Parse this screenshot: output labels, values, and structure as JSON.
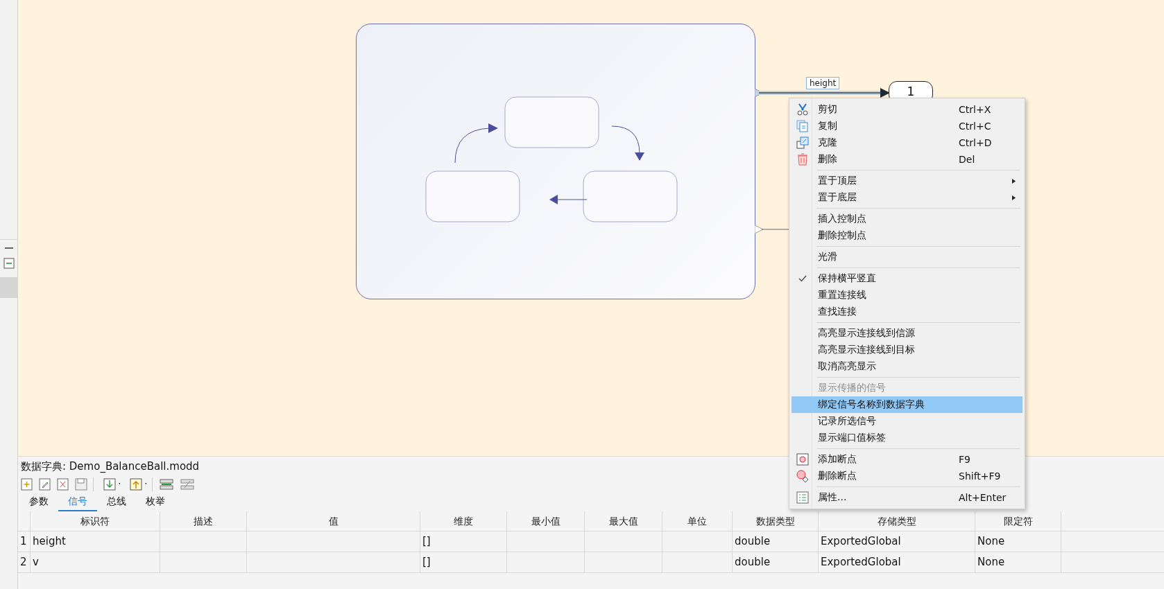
{
  "diagram": {
    "signal_label": "height",
    "outport_label": "1"
  },
  "context_menu": {
    "groups": [
      [
        {
          "label": "剪切",
          "shortcut": "Ctrl+X",
          "has_submenu": false,
          "checked": false,
          "disabled": false,
          "selected": false
        },
        {
          "label": "复制",
          "shortcut": "Ctrl+C",
          "has_submenu": false,
          "checked": false,
          "disabled": false,
          "selected": false
        },
        {
          "label": "克隆",
          "shortcut": "Ctrl+D",
          "has_submenu": false,
          "checked": false,
          "disabled": false,
          "selected": false
        },
        {
          "label": "删除",
          "shortcut": "Del",
          "has_submenu": false,
          "checked": false,
          "disabled": false,
          "selected": false
        }
      ],
      [
        {
          "label": "置于顶层",
          "has_submenu": true,
          "checked": false,
          "disabled": false,
          "selected": false
        },
        {
          "label": "置于底层",
          "has_submenu": true,
          "checked": false,
          "disabled": false,
          "selected": false
        }
      ],
      [
        {
          "label": "插入控制点",
          "has_submenu": false,
          "checked": false,
          "disabled": false,
          "selected": false
        },
        {
          "label": "删除控制点",
          "has_submenu": false,
          "checked": false,
          "disabled": false,
          "selected": false
        }
      ],
      [
        {
          "label": "光滑",
          "has_submenu": false,
          "checked": false,
          "disabled": false,
          "selected": false
        }
      ],
      [
        {
          "label": "保持横平竖直",
          "has_submenu": false,
          "checked": true,
          "disabled": false,
          "selected": false
        },
        {
          "label": "重置连接线",
          "has_submenu": false,
          "checked": false,
          "disabled": false,
          "selected": false
        },
        {
          "label": "查找连接",
          "has_submenu": false,
          "checked": false,
          "disabled": false,
          "selected": false
        }
      ],
      [
        {
          "label": "高亮显示连接线到信源",
          "has_submenu": false,
          "checked": false,
          "disabled": false,
          "selected": false
        },
        {
          "label": "高亮显示连接线到目标",
          "has_submenu": false,
          "checked": false,
          "disabled": false,
          "selected": false
        },
        {
          "label": "取消高亮显示",
          "has_submenu": false,
          "checked": false,
          "disabled": false,
          "selected": false
        }
      ],
      [
        {
          "label": "显示传播的信号",
          "has_submenu": false,
          "checked": false,
          "disabled": true,
          "selected": false
        },
        {
          "label": "绑定信号名称到数据字典",
          "has_submenu": false,
          "checked": false,
          "disabled": false,
          "selected": true
        },
        {
          "label": "记录所选信号",
          "has_submenu": false,
          "checked": false,
          "disabled": false,
          "selected": false
        },
        {
          "label": "显示端口值标签",
          "has_submenu": false,
          "checked": false,
          "disabled": false,
          "selected": false
        }
      ],
      [
        {
          "label": "添加断点",
          "shortcut": "F9",
          "has_submenu": false,
          "checked": false,
          "disabled": false,
          "selected": false
        },
        {
          "label": "删除断点",
          "shortcut": "Shift+F9",
          "has_submenu": false,
          "checked": false,
          "disabled": false,
          "selected": false
        }
      ],
      [
        {
          "label": "属性...",
          "shortcut": "Alt+Enter",
          "has_submenu": false,
          "checked": false,
          "disabled": false,
          "selected": false
        }
      ]
    ]
  },
  "data_dictionary": {
    "title": "数据字典: Demo_BalanceBall.modd",
    "tabs": [
      {
        "label": "参数",
        "selected": false
      },
      {
        "label": "信号",
        "selected": true
      },
      {
        "label": "总线",
        "selected": false
      },
      {
        "label": "枚举",
        "selected": false
      }
    ],
    "table": {
      "columns": [
        "标识符",
        "描述",
        "值",
        "维度",
        "最小值",
        "最大值",
        "单位",
        "数据类型",
        "存储类型",
        "限定符"
      ],
      "rows": [
        {
          "index": "1",
          "cells": [
            "height",
            "",
            "",
            "[]",
            "",
            "",
            "",
            "double",
            "ExportedGlobal",
            "None"
          ]
        },
        {
          "index": "2",
          "cells": [
            "v",
            "",
            "",
            "[]",
            "",
            "",
            "",
            "double",
            "ExportedGlobal",
            "None"
          ]
        }
      ]
    }
  }
}
